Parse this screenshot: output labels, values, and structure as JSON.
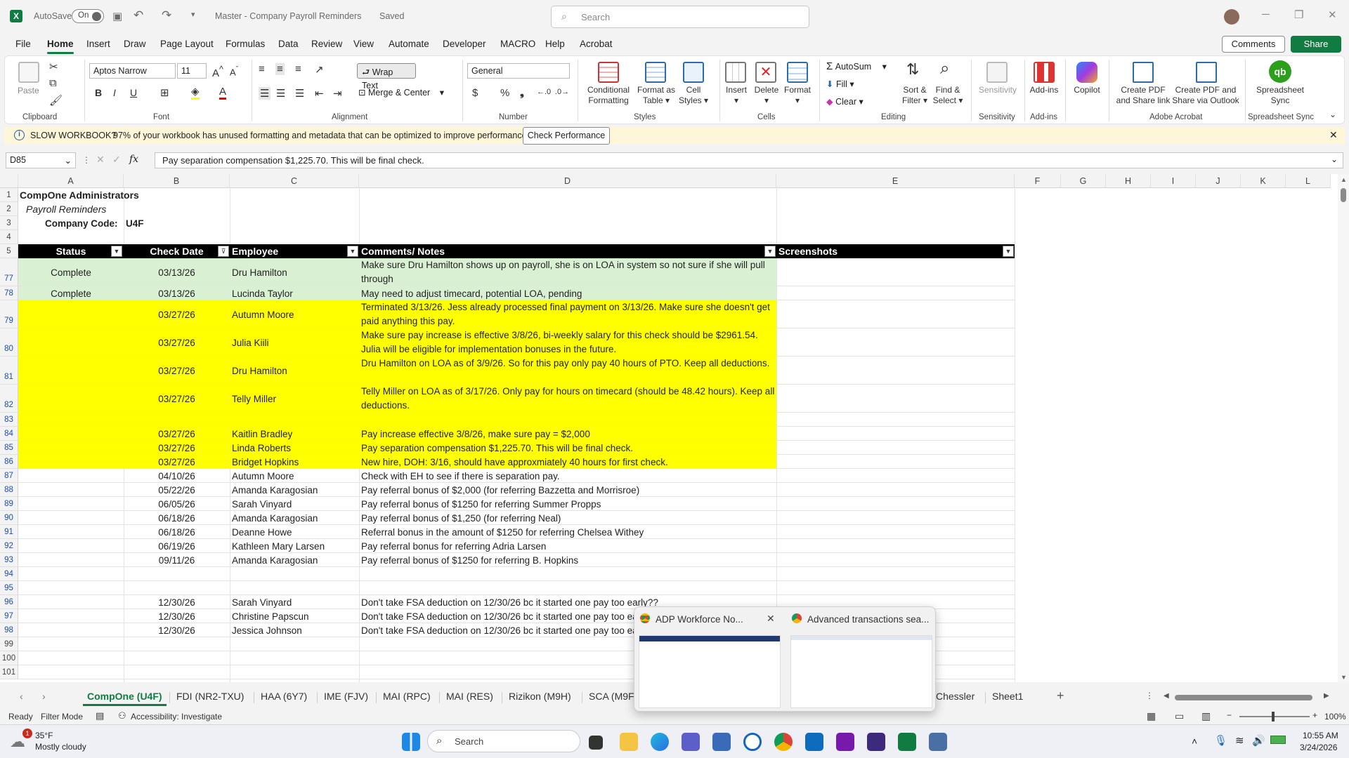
{
  "titlebar": {
    "autosave_label": "AutoSave",
    "autosave_state": "On",
    "doc_title": "Master - Company Payroll Reminders",
    "saved_state": "Saved",
    "search_placeholder": "Search"
  },
  "menu": [
    "File",
    "Home",
    "Insert",
    "Draw",
    "Page Layout",
    "Formulas",
    "Data",
    "Review",
    "View",
    "Automate",
    "Developer",
    "MACRO",
    "Help",
    "Acrobat"
  ],
  "menu_active": "Home",
  "comments_label": "Comments",
  "share_label": "Share",
  "ribbon": {
    "paste": "Paste",
    "clipboard": "Clipboard",
    "font_name": "Aptos Narrow",
    "font_size": "11",
    "font": "Font",
    "wrap_text": "Wrap Text",
    "merge_center": "Merge & Center",
    "alignment": "Alignment",
    "number_format": "General",
    "number": "Number",
    "conditional_formatting_1": "Conditional",
    "conditional_formatting_2": "Formatting",
    "format_table_1": "Format as",
    "format_table_2": "Table",
    "cell_styles_1": "Cell",
    "cell_styles_2": "Styles",
    "styles": "Styles",
    "insert": "Insert",
    "delete": "Delete",
    "format": "Format",
    "cells": "Cells",
    "autosum": "AutoSum",
    "fill": "Fill",
    "clear": "Clear",
    "sort_filter_1": "Sort &",
    "sort_filter_2": "Filter",
    "find_select_1": "Find &",
    "find_select_2": "Select",
    "editing": "Editing",
    "sensitivity": "Sensitivity",
    "sensitivity_group": "Sensitivity",
    "addins": "Add-ins",
    "addins_group": "Add-ins",
    "copilot": "Copilot",
    "create_pdf_share_1": "Create PDF",
    "create_pdf_share_2": "and Share link",
    "create_pdf_outlook_1": "Create PDF and",
    "create_pdf_outlook_2": "Share via Outlook",
    "adobe_acrobat": "Adobe Acrobat",
    "spreadsheet_sync_1": "Spreadsheet",
    "spreadsheet_sync_2": "Sync",
    "spreadsheet_sync_group": "Spreadsheet Sync"
  },
  "message_bar": {
    "title": "SLOW WORKBOOK?",
    "text": "97% of your workbook has unused formatting and metadata that can be optimized to improve performance.",
    "button": "Check Performance"
  },
  "formula_bar": {
    "name_box": "D85",
    "fx": "fx",
    "content": "Pay separation compensation $1,225.70. This will be final check."
  },
  "columns": [
    "A",
    "B",
    "C",
    "D",
    "E",
    "F",
    "G",
    "H",
    "I",
    "J",
    "K",
    "L"
  ],
  "header_rows": {
    "r1": "CompOne Administrators",
    "r2": "Payroll Reminders",
    "r3_label": "Company Code:",
    "r3_value": "U4F"
  },
  "table_headers": [
    "Status",
    "Check Date",
    "Employee",
    "Comments/ Notes",
    "Screenshots"
  ],
  "rows": [
    {
      "n": "77",
      "status": "Complete",
      "date": "03/13/26",
      "employee": "Dru Hamilton",
      "note": "Make sure Dru Hamilton shows up on payroll, she is on LOA in system so not sure if she will pull through",
      "fill": "green"
    },
    {
      "n": "78",
      "status": "Complete",
      "date": "03/13/26",
      "employee": "Lucinda Taylor",
      "note": "May need to adjust timecard, potential LOA, pending",
      "fill": "green"
    },
    {
      "n": "79",
      "status": "",
      "date": "03/27/26",
      "employee": "Autumn Moore",
      "note": "Terminated 3/13/26. Jess already processed final payment on 3/13/26. Make sure she doesn't get paid anything this pay.",
      "fill": "yellow"
    },
    {
      "n": "80",
      "status": "",
      "date": "03/27/26",
      "employee": "Julia Kiili",
      "note": "Make sure pay increase is effective 3/8/26, bi-weekly salary for this check should be $2961.54. Julia will be eligible for implementation bonuses in the future.",
      "fill": "yellow"
    },
    {
      "n": "81",
      "status": "",
      "date": "03/27/26",
      "employee": "Dru Hamilton",
      "note": "Dru Hamilton on LOA as of 3/9/26. So for this pay only pay 40 hours of PTO. Keep all deductions.",
      "fill": "yellow"
    },
    {
      "n": "82",
      "status": "",
      "date": "03/27/26",
      "employee": "Telly Miller",
      "note": "Telly Miller on LOA as of 3/17/26. Only pay for hours on timecard (should be 48.42 hours). Keep all deductions.",
      "fill": "yellow"
    },
    {
      "n": "83",
      "status": "",
      "date": "",
      "employee": "",
      "note": "",
      "fill": "yellow"
    },
    {
      "n": "84",
      "status": "",
      "date": "03/27/26",
      "employee": "Kaitlin Bradley",
      "note": "Pay increase effective 3/8/26, make sure pay = $2,000",
      "fill": "yellow"
    },
    {
      "n": "85",
      "status": "",
      "date": "03/27/26",
      "employee": "Linda Roberts",
      "note": "Pay separation compensation $1,225.70. This will be final check.",
      "fill": "yellow"
    },
    {
      "n": "86",
      "status": "",
      "date": "03/27/26",
      "employee": "Bridget Hopkins",
      "note": "New hire, DOH: 3/16, should have approxmiately 40 hours for first check.",
      "fill": "yellow"
    },
    {
      "n": "87",
      "status": "",
      "date": "04/10/26",
      "employee": "Autumn Moore",
      "note": "Check with EH to see if there is separation pay.",
      "fill": "none"
    },
    {
      "n": "88",
      "status": "",
      "date": "05/22/26",
      "employee": "Amanda Karagosian",
      "note": "Pay referral bonus of $2,000 (for referring Bazzetta and Morrisroe)",
      "fill": "none"
    },
    {
      "n": "89",
      "status": "",
      "date": "06/05/26",
      "employee": "Sarah Vinyard",
      "note": "Pay referral bonus of $1250 for referring Summer Propps",
      "fill": "none"
    },
    {
      "n": "90",
      "status": "",
      "date": "06/18/26",
      "employee": "Amanda Karagosian",
      "note": "Pay referral bonus of $1,250 (for referring Neal)",
      "fill": "none"
    },
    {
      "n": "91",
      "status": "",
      "date": "06/18/26",
      "employee": "Deanne Howe",
      "note": "Referral bonus in the amount of $1250 for referring Chelsea Withey",
      "fill": "none"
    },
    {
      "n": "92",
      "status": "",
      "date": "06/19/26",
      "employee": "Kathleen Mary Larsen",
      "note": "Pay referral bonus for referring Adria Larsen",
      "fill": "none"
    },
    {
      "n": "93",
      "status": "",
      "date": "09/11/26",
      "employee": "Amanda Karagosian",
      "note": "Pay referral bonus of $1250 for referring B. Hopkins",
      "fill": "none"
    },
    {
      "n": "94",
      "status": "",
      "date": "",
      "employee": "",
      "note": "",
      "fill": "none"
    },
    {
      "n": "95",
      "status": "",
      "date": "",
      "employee": "",
      "note": "",
      "fill": "none"
    },
    {
      "n": "96",
      "status": "",
      "date": "12/30/26",
      "employee": "Sarah Vinyard",
      "note": "Don't take FSA deduction on 12/30/26 bc it started one pay too early??",
      "fill": "none"
    },
    {
      "n": "97",
      "status": "",
      "date": "12/30/26",
      "employee": "Christine Papscun",
      "note": "Don't take FSA deduction on 12/30/26 bc it started one pay too ea",
      "fill": "none"
    },
    {
      "n": "98",
      "status": "",
      "date": "12/30/26",
      "employee": "Jessica Johnson",
      "note": "Don't take FSA deduction on 12/30/26 bc it started one pay too ea",
      "fill": "none"
    },
    {
      "n": "99",
      "status": "",
      "date": "",
      "employee": "",
      "note": "",
      "fill": "none"
    },
    {
      "n": "100",
      "status": "",
      "date": "",
      "employee": "",
      "note": "",
      "fill": "none"
    },
    {
      "n": "101",
      "status": "",
      "date": "",
      "employee": "",
      "note": "",
      "fill": "none"
    }
  ],
  "sheet_tabs": [
    "CompOne (U4F)",
    "FDI (NR2-TXU)",
    "HAA (6Y7)",
    "IME (FJV)",
    "MAI (RPC)",
    "MAI (RES)",
    "Rizikon (M9H)",
    "SCA (M9F)",
    "Chessler",
    "Sheet1"
  ],
  "active_sheet": "CompOne (U4F)",
  "status_bar": {
    "ready": "Ready",
    "filter_mode": "Filter Mode",
    "accessibility": "Accessibility: Investigate",
    "zoom": "100%"
  },
  "popup": {
    "tab1": "ADP Workforce No...",
    "tab2": "Advanced transactions sea..."
  },
  "taskbar": {
    "weather_temp": "35°F",
    "weather_desc": "Mostly cloudy",
    "weather_badge": "1",
    "search": "Search",
    "time": "10:55 AM",
    "date": "3/24/2026"
  },
  "colors": {
    "excel_green": "#107c41",
    "row_green": "#d9f0d3",
    "row_yellow": "#ffff00",
    "header_black": "#000000"
  }
}
